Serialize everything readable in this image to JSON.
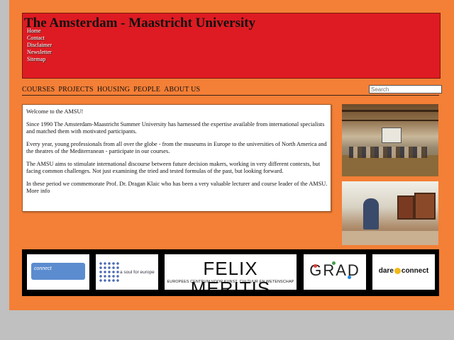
{
  "header": {
    "title": "The Amsterdam - Maastricht University",
    "util_links": [
      "Home",
      "Contact",
      "Disclaimer",
      "Newsletter",
      "Sitemap"
    ]
  },
  "nav": {
    "items": [
      "COURSES",
      "PROJECTS",
      "HOUSING",
      "PEOPLE",
      "ABOUT US"
    ]
  },
  "search": {
    "placeholder": "Search"
  },
  "content": {
    "paragraphs": [
      "Welcome to the AMSU!",
      "Since 1990 The Amsterdam-Maastricht Summer University has harnessed the expertise available from international specialists and matched them with motivated participants.",
      "Every year, young professionals from all over the globe - from the museums in Europe to the universities of North America and the theatres of the Mediterranean - participate in our courses.",
      "The AMSU aims to stimulate international discourse between future decision makers, working in very different contexts, but facing common challenges. Not just examining the tried and tested formulas of the past, but looking forward.",
      "In these period we commemorate Prof. Dr. Dragan Klaic who has been a very valuable lecturer and course leader of the AMSU. More info"
    ]
  },
  "logos": {
    "gc": "connect",
    "sfe": "a soul for europe",
    "fm_big": "FELIX MERITIS",
    "fm_small": "EUROPEES CENTRUM VOOR KUNST, CULTUUR EN WETENSCHAP",
    "grad": "GRAD",
    "dc_left": "dare",
    "dc_right": "connect"
  },
  "colors": {
    "page_bg": "#f47f36",
    "header_bg": "#de1b22",
    "outer_bg": "#c0c0c0"
  }
}
